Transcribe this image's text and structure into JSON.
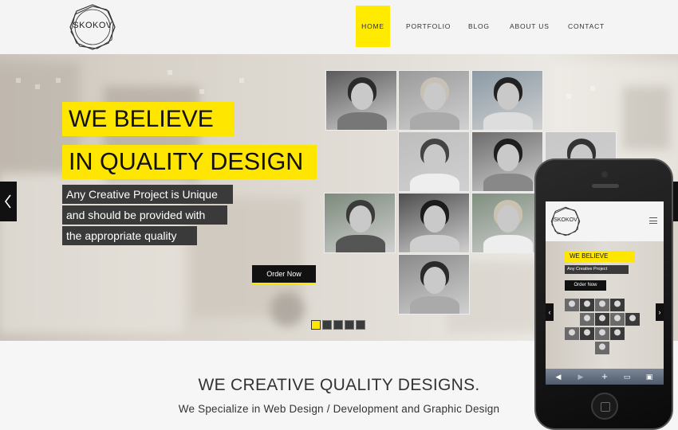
{
  "header": {
    "logo_text": "SKOKOV",
    "nav": [
      "HOME",
      "PORTFOLIO",
      "BLOG",
      "ABOUT US",
      "CONTACT"
    ],
    "active_nav": "HOME"
  },
  "hero": {
    "headline_line1": "WE BELIEVE",
    "headline_line2": "IN QUALITY DESIGN",
    "sub_line1": "Any Creative Project is Unique",
    "sub_line2": "and should be provided with",
    "sub_line3": "the appropriate quality",
    "cta_label": "Order Now",
    "prev_icon": "chevron-left-icon",
    "next_icon": "chevron-right-icon",
    "slide_count": 5,
    "active_slide": 1
  },
  "section": {
    "title": "WE CREATIVE QUALITY DESIGNS.",
    "subtitle": "We Specialize in Web Design / Development and Graphic Design"
  },
  "phone": {
    "logo_text": "SKOKOV",
    "headline": "WE BELIEVE",
    "sub": "Any Creative Project",
    "cta_label": "Order Now",
    "toolbar_icons": [
      "back-icon",
      "forward-icon",
      "add-icon",
      "bookmarks-icon",
      "tabs-icon"
    ]
  },
  "colors": {
    "accent": "#ffe600",
    "dark": "#3a3a3a",
    "black": "#111111"
  }
}
